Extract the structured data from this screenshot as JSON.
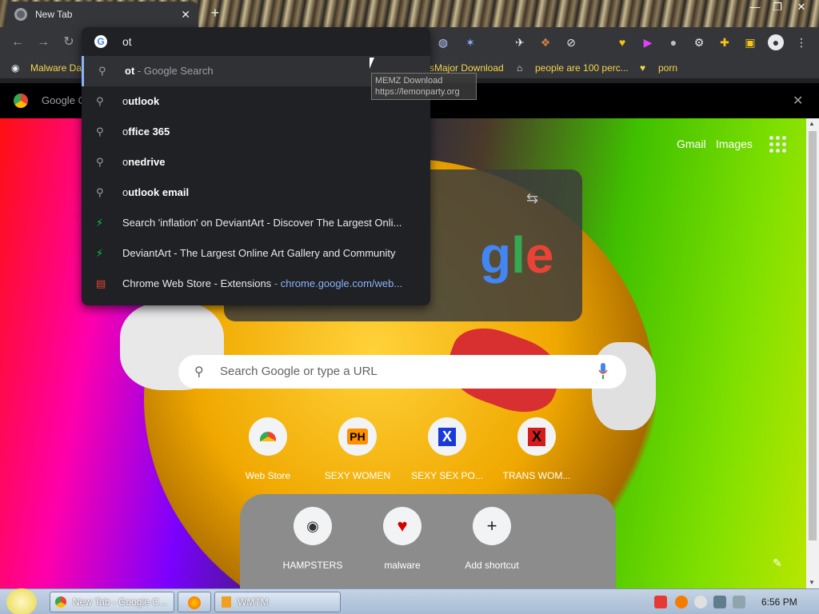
{
  "window": {
    "tab_title": "New Tab",
    "tab_close": "✕",
    "new_tab": "+"
  },
  "omnibox": {
    "typed": "ot",
    "suggestions": [
      {
        "icon": "search",
        "bold": "",
        "rest": "ot",
        "suffix": " - Google Search",
        "url": ""
      },
      {
        "icon": "search",
        "prefix": "o",
        "bold": "utlook",
        "suffix": "",
        "url": ""
      },
      {
        "icon": "search",
        "prefix": "o",
        "bold": "ffice 365",
        "suffix": "",
        "url": ""
      },
      {
        "icon": "search",
        "prefix": "o",
        "bold": "nedrive",
        "suffix": "",
        "url": ""
      },
      {
        "icon": "search",
        "prefix": "o",
        "bold": "utlook email",
        "suffix": "",
        "url": ""
      },
      {
        "icon": "deviantart",
        "text": "Search 'inflation' on DeviantArt - Discover The Largest Onli...",
        "url": ""
      },
      {
        "icon": "deviantart",
        "text": "DeviantArt - The Largest Online Art Gallery and Community",
        "url": ""
      },
      {
        "icon": "webstore",
        "text": "Chrome Web Store - Extensions",
        "sep": " - ",
        "url": "chrome.google.com/web..."
      }
    ]
  },
  "tooltip": {
    "line1": "MEMZ Download",
    "line2": "https://lemonparty.org"
  },
  "bookmarks": [
    "Malware Da",
    "sMajor Download",
    "people are 100 perc...",
    "porn"
  ],
  "infobar": {
    "text": "Google C",
    "close": "✕"
  },
  "ntp": {
    "gmail": "Gmail",
    "images": "Images",
    "search_placeholder": "Search Google or type a URL",
    "shortcuts_row1": [
      {
        "label": "Web Store",
        "glyph": ""
      },
      {
        "label": "SEXY WOMEN",
        "glyph": "PH"
      },
      {
        "label": "SEXY SEX PO...",
        "glyph": "X"
      },
      {
        "label": "TRANS WOM...",
        "glyph": "X"
      }
    ],
    "shortcuts_row2": [
      {
        "label": "HAMPSTERS",
        "glyph": ""
      },
      {
        "label": "malware",
        "glyph": "♥"
      },
      {
        "label": "Add shortcut",
        "glyph": "+"
      }
    ]
  },
  "taskbar": {
    "chrome_task": "New Tab - Google C...",
    "wmtm_task": "WMTM",
    "clock": "6:56 PM"
  }
}
